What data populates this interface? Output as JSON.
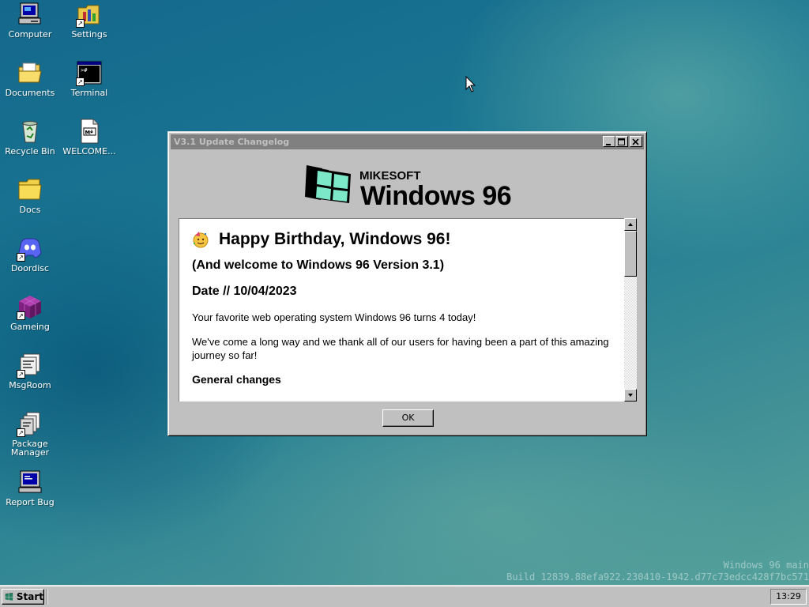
{
  "desktop": {
    "icons": [
      {
        "label": "Computer",
        "icon": "computer-icon"
      },
      {
        "label": "Settings",
        "icon": "settings-icon"
      },
      {
        "label": "Documents",
        "icon": "documents-folder-icon"
      },
      {
        "label": "Terminal",
        "icon": "terminal-icon"
      },
      {
        "label": "Recycle Bin",
        "icon": "recycle-bin-icon"
      },
      {
        "label": "WELCOME...",
        "icon": "markdown-file-icon"
      },
      {
        "label": "Docs",
        "icon": "folder-icon"
      },
      {
        "label": "Doordisc",
        "icon": "doordisc-icon"
      },
      {
        "label": "Gameing",
        "icon": "game-cube-icon"
      },
      {
        "label": "MsgRoom",
        "icon": "msgroom-icon"
      },
      {
        "label": "Package Manager",
        "icon": "package-manager-icon"
      },
      {
        "label": "Report Bug",
        "icon": "report-bug-icon"
      }
    ]
  },
  "window": {
    "title": "V3.1 Update Changelog",
    "logo": {
      "brand": "MIKESOFT",
      "product": "Windows 96"
    },
    "content": {
      "heading": "Happy Birthday, Windows 96!",
      "subheading": "(And welcome to Windows 96 Version 3.1)",
      "date": "Date // 10/04/2023",
      "paragraph1": "Your favorite web operating system Windows 96 turns 4 today!",
      "paragraph2": "We've come a long way and we thank all of our users for having been a part of this amazing journey so far!",
      "section": "General changes"
    },
    "ok_label": "OK"
  },
  "watermark": {
    "line1": "Windows 96 main",
    "line2": "Build 12839.88efa922.230410-1942.d77c73edcc428f7bc571"
  },
  "taskbar": {
    "start_label": "Start",
    "clock": "13:29"
  },
  "colors": {
    "desktop": "#1a7892",
    "window_face": "#c0c0c0",
    "titlebar_inactive": "#808080"
  }
}
